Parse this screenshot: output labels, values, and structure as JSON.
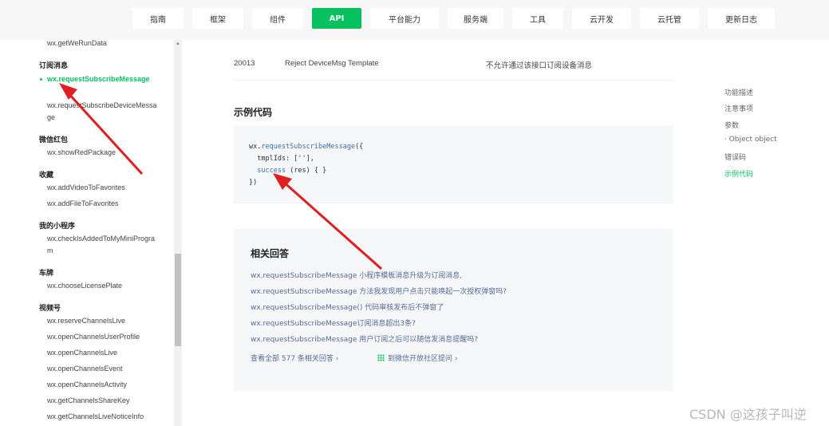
{
  "nav": {
    "tabs": [
      "指南",
      "框架",
      "组件",
      "API",
      "平台能力",
      "服务端",
      "工具",
      "云开发",
      "云托管",
      "更新日志"
    ],
    "active_tab": "API"
  },
  "sidebar": {
    "top_item": "wx.getWeRunData",
    "groups": [
      {
        "title": "订阅消息",
        "items": [
          "wx.requestSubscribeMessage",
          "wx.requestSubscribeDeviceMessage"
        ]
      },
      {
        "title": "微信红包",
        "items": [
          "wx.showRedPackage"
        ]
      },
      {
        "title": "收藏",
        "items": [
          "wx.addVideoToFavorites",
          "wx.addFileToFavorites"
        ]
      },
      {
        "title": "我的小程序",
        "items": [
          "wx.checkIsAddedToMyMiniProgram"
        ]
      },
      {
        "title": "车牌",
        "items": [
          "wx.chooseLicensePlate"
        ]
      },
      {
        "title": "视频号",
        "items": [
          "wx.reserveChannelsLive",
          "wx.openChannelsUserProfile",
          "wx.openChannelsLive",
          "wx.openChannelsEvent",
          "wx.openChannelsActivity",
          "wx.getChannelsShareKey",
          "wx.getChannelsLiveNoticeInfo"
        ]
      }
    ],
    "active_item": "wx.requestSubscribeMessage"
  },
  "error_row": {
    "code": "20013",
    "name": "Reject DeviceMsg Template",
    "desc": "不允许通过该接口订阅设备消息"
  },
  "example": {
    "heading": "示例代码",
    "code": {
      "line1_prefix": "wx.",
      "line1_fn": "requestSubscribeMessage",
      "line1_suffix": "({",
      "line2": "  tmplIds: [''],",
      "line3_kw": "success",
      "line3_rest": " (res) { }",
      "line4": "})"
    }
  },
  "related": {
    "title": "相关回答",
    "links": [
      "wx.requestSubscribeMessage 小程序模板消息升级为订阅消息,",
      "wx.requestSubscribeMessage 方法我发现用户点击只能唤起一次授权弹窗吗?",
      "wx.requestSubscribeMessage() 代码审核发布后不弹窗了",
      "wx.requestSubscribeMessage订阅消息超出3条?",
      "wx.requestSubscribeMessage 用户订阅之后可以随信发消息提醒吗?"
    ],
    "view_all": "查看全部 577 条相关回答 ›",
    "ask": "到微信开放社区提问 ›"
  },
  "toc": {
    "items": [
      "功能描述",
      "注意事项",
      "参数",
      "· Object object",
      "错误码",
      "示例代码"
    ],
    "active": "示例代码"
  },
  "watermark": "CSDN @这孩子叫逆",
  "colors": {
    "accent": "#07c160",
    "link": "#576b95",
    "arrow": "#e02020"
  }
}
